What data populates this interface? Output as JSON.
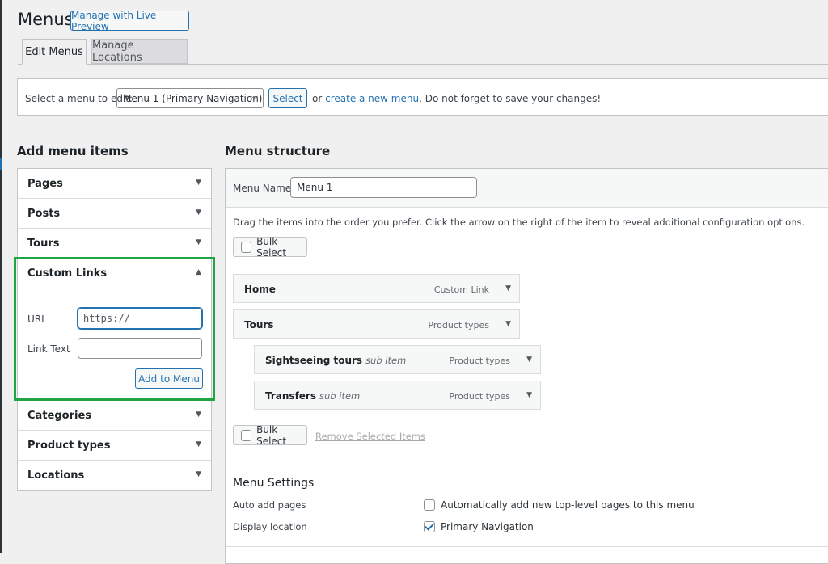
{
  "header": {
    "title": "Menus",
    "live_preview_label": "Manage with Live Preview"
  },
  "tabs": [
    {
      "label": "Edit Menus",
      "active": true
    },
    {
      "label": "Manage Locations",
      "active": false
    }
  ],
  "manage": {
    "select_label": "Select a menu to edit:",
    "selected_menu": "Menu 1 (Primary Navigation)",
    "select_button": "Select",
    "or_text": "or",
    "create_link": "create a new menu",
    "trailing_text": ". Do not forget to save your changes!"
  },
  "add_items": {
    "heading": "Add menu items",
    "sections_before": [
      {
        "label": "Pages"
      },
      {
        "label": "Posts"
      },
      {
        "label": "Tours"
      }
    ],
    "custom_links": {
      "label": "Custom Links",
      "url_label": "URL",
      "url_placeholder": "https://",
      "link_text_label": "Link Text",
      "link_text_value": "",
      "add_button": "Add to Menu"
    },
    "sections_after": [
      {
        "label": "Categories"
      },
      {
        "label": "Product types"
      },
      {
        "label": "Locations"
      }
    ]
  },
  "structure": {
    "heading": "Menu structure",
    "menu_name_label": "Menu Name",
    "menu_name_value": "Menu 1",
    "instructions": "Drag the items into the order you prefer. Click the arrow on the right of the item to reveal additional configuration options.",
    "bulk_select_label": "Bulk Select",
    "remove_label": "Remove Selected Items",
    "items": [
      {
        "title": "Home",
        "sub": "",
        "type": "Custom Link"
      },
      {
        "title": "Tours",
        "sub": "",
        "type": "Product types"
      },
      {
        "title": "Sightseeing tours",
        "sub": "sub item",
        "type": "Product types"
      },
      {
        "title": "Transfers",
        "sub": "sub item",
        "type": "Product types"
      }
    ]
  },
  "settings": {
    "heading": "Menu Settings",
    "auto_add_label": "Auto add pages",
    "auto_add_option": "Automatically add new top-level pages to this menu",
    "auto_add_checked": false,
    "display_location_label": "Display location",
    "display_location_option": "Primary Navigation",
    "display_location_checked": true
  },
  "colors": {
    "accent": "#2271b1",
    "highlight_box": "#21a543",
    "background": "#f0f0f1"
  }
}
